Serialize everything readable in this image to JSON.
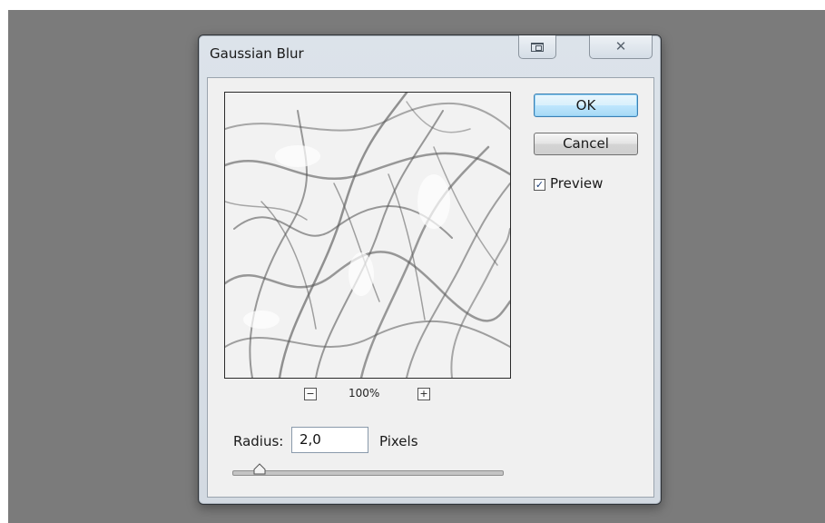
{
  "window": {
    "title": "Gaussian Blur",
    "restore_icon": "restore-window-icon",
    "close_icon": "close-x-icon",
    "close_glyph": "☒"
  },
  "preview_image": {
    "zoom_out_glyph": "−",
    "zoom_in_glyph": "+",
    "zoom_level": "100%"
  },
  "controls": {
    "radius_label": "Radius:",
    "radius_value": "2,0",
    "radius_unit": "Pixels",
    "radius_slider_fraction": 0.1
  },
  "buttons": {
    "ok_label": "OK",
    "cancel_label": "Cancel"
  },
  "preview_toggle": {
    "label": "Preview",
    "checked": true,
    "check_glyph": "✓"
  },
  "colors": {
    "backdrop": "#7b7b7b",
    "dialog_frame": "#d6dde5",
    "client": "#f0f0f0",
    "ok_accent": "#3c7fb1"
  }
}
